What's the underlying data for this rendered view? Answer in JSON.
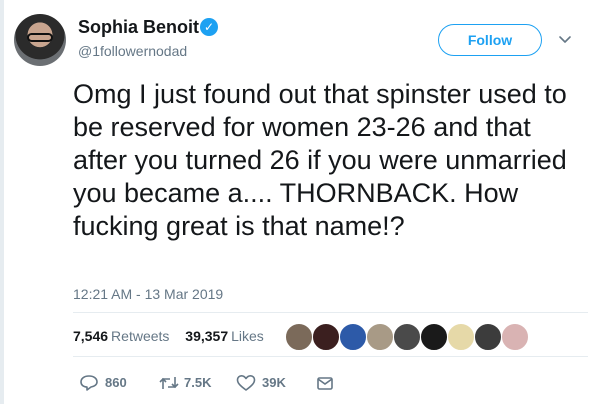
{
  "author": {
    "name": "Sophia Benoit",
    "handle": "@1followernodad",
    "verified_icon": "✓"
  },
  "follow_button": {
    "label": "Follow"
  },
  "tweet": {
    "text": "Omg I just found out that spinster used to be reserved for women 23-26 and that after you turned 26 if you were unmarried you became a.... THORNBACK. How fucking great is that name!?",
    "timestamp": "12:21 AM - 13 Mar 2019"
  },
  "stats": {
    "retweets_count": "7,546",
    "retweets_label": "Retweets",
    "likes_count": "39,357",
    "likes_label": "Likes"
  },
  "liker_colors": [
    "#7b6a5a",
    "#3b1f1f",
    "#2d5aa8",
    "#a89a86",
    "#4a4a4a",
    "#1a1a1a",
    "#e6d9a8",
    "#3c3c3c",
    "#d9b3b3"
  ],
  "actions": {
    "reply_count": "860",
    "retweet_count": "7.5K",
    "like_count": "39K"
  },
  "colors": {
    "accent": "#1da1f2",
    "text": "#14171a",
    "muted": "#657786"
  }
}
